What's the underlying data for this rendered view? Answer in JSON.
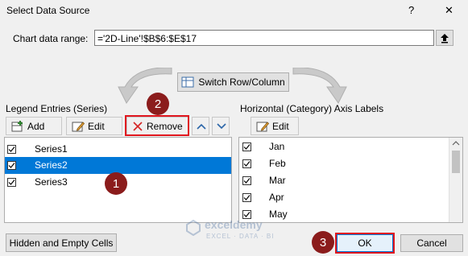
{
  "dialog": {
    "title": "Select Data Source",
    "help_label": "?",
    "close_label": "✕"
  },
  "data_range": {
    "label": "Chart data range:",
    "value": "='2D-Line'!$B$6:$E$17"
  },
  "switch_button": {
    "label": "Switch Row/Column"
  },
  "legend": {
    "header": "Legend Entries (Series)",
    "add_label": "Add",
    "edit_label": "Edit",
    "remove_label": "Remove",
    "series": [
      {
        "label": "Series1",
        "checked": true,
        "selected": false
      },
      {
        "label": "Series2",
        "checked": true,
        "selected": true
      },
      {
        "label": "Series3",
        "checked": true,
        "selected": false
      }
    ]
  },
  "axis": {
    "header": "Horizontal (Category) Axis Labels",
    "edit_label": "Edit",
    "items": [
      {
        "label": "Jan",
        "checked": true
      },
      {
        "label": "Feb",
        "checked": true
      },
      {
        "label": "Mar",
        "checked": true
      },
      {
        "label": "Apr",
        "checked": true
      },
      {
        "label": "May",
        "checked": true
      }
    ]
  },
  "footer": {
    "hidden_cells_label": "Hidden and Empty Cells",
    "ok_label": "OK",
    "cancel_label": "Cancel"
  },
  "markers": {
    "one": "1",
    "two": "2",
    "three": "3"
  },
  "watermark": {
    "brand": "exceldemy",
    "tagline": "EXCEL · DATA · BI"
  },
  "colors": {
    "selection": "#0078d7",
    "highlight": "#e0161e",
    "marker": "#8b1c1c"
  }
}
